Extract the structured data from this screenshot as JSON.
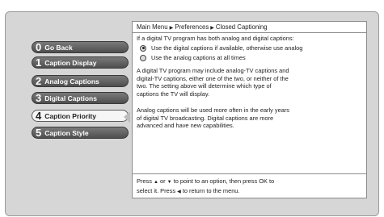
{
  "menu": {
    "items": [
      {
        "number": "0",
        "label": "Go Back"
      },
      {
        "number": "1",
        "label": "Caption Display"
      },
      {
        "number": "2",
        "label": "Analog Captions"
      },
      {
        "number": "3",
        "label": "Digital Captions"
      },
      {
        "number": "4",
        "label": "Caption Priority"
      },
      {
        "number": "5",
        "label": "Caption Style"
      }
    ],
    "selected_index": 4
  },
  "panel": {
    "breadcrumb": [
      "Main Menu",
      "Preferences",
      "Closed Captioning"
    ],
    "question": "If a digital TV program has both analog and digital captions:",
    "options": [
      {
        "label": "Use the digital captions if available, otherwise use analog",
        "selected": true
      },
      {
        "label": "Use the analog captions at all times",
        "selected": false
      }
    ],
    "paragraph1_lines": [
      "A digital TV program may include analog-TV captions and",
      "digital-TV captions, either one of the two, or neither of the",
      "two. The setting above will determine which type of",
      "captions the TV will display."
    ],
    "paragraph2_lines": [
      "Analog captions will be used more often in the early years",
      "of digital TV broadcasting.  Digital captions are more",
      "advanced and have new capabilities."
    ],
    "footer": {
      "press1": "Press",
      "or": "or",
      "point_text": "to point to an option, then press OK to",
      "line2_a": "select it. Press",
      "line2_b": "to return to the menu."
    }
  },
  "icons": {
    "breadcrumb_separator": "right-triangle-icon",
    "up": "up-triangle-icon",
    "down": "down-triangle-icon",
    "left": "left-triangle-icon"
  },
  "colors": {
    "menu_button": "#5e5e5e",
    "menu_selected": "#f6f6f6",
    "frame": "#d6d6d6"
  }
}
